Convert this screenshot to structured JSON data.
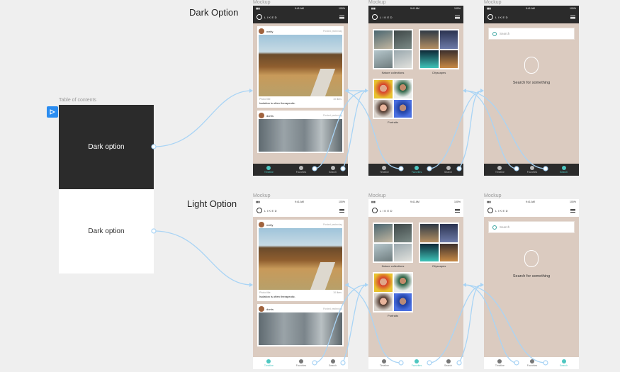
{
  "toc": {
    "label": "Table of contents",
    "dark_card_label": "Dark option",
    "light_card_label": "Dark option"
  },
  "sections": {
    "dark_title": "Dark Option",
    "light_title": "Light Option"
  },
  "frame_label": "Mockup",
  "status": {
    "time": "9:41 AM",
    "battery": "100%"
  },
  "app": {
    "logo_text": "LIKED"
  },
  "feed": {
    "post1": {
      "user": "melly",
      "time": "Posted yesterday",
      "photo_title": "Photo title",
      "likes": "10 likes",
      "caption": "Isolation is often therapeutic."
    },
    "post2": {
      "user": "dorris",
      "time": "Posted yesterday"
    }
  },
  "collections": {
    "nature": "Nature collections",
    "cityscapes": "Cityscapes",
    "portraits": "Portraits"
  },
  "search": {
    "placeholder": "Search",
    "empty_text": "Search for something"
  },
  "tabs": {
    "timeline": "Timeline",
    "favorites": "Favorites",
    "search": "Search"
  },
  "colors": {
    "accent": "#4ec7c1",
    "phone_bg": "#dbcbc0",
    "dark_bar": "#2b2b2b",
    "connector": "#a9d4f5",
    "play_badge": "#2a8cf0"
  }
}
